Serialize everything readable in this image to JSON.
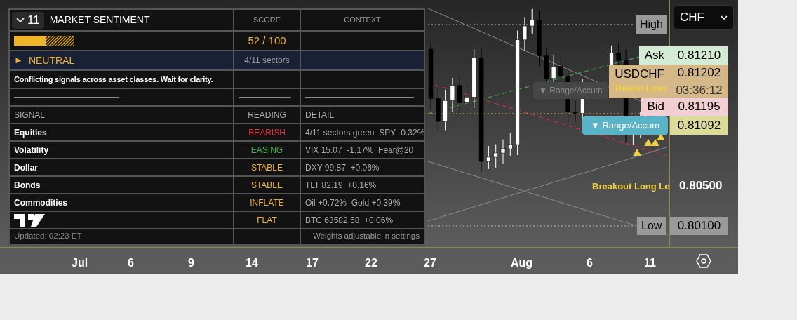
{
  "interval_button": {
    "label": "11"
  },
  "sentiment": {
    "title": "MARKET SENTIMENT",
    "columns": [
      "SCORE",
      "CONTEXT"
    ],
    "level": 0.52,
    "score": "52 / 100",
    "status": {
      "marker": "►",
      "label": "NEUTRAL",
      "sectors": "4/11 sectors"
    },
    "message": "Conflicting signals across asset classes. Wait for clarity.",
    "signal_columns": [
      "SIGNAL",
      "READING",
      "DETAIL"
    ],
    "signals": [
      {
        "name": "Equities",
        "reading": "BEARISH",
        "color": "#e0303a",
        "detail": "4/11 sectors green  SPY -0.32%"
      },
      {
        "name": "Volatility",
        "reading": "EASING",
        "color": "#3cb043",
        "detail": "VIX 15.07  -1.17%  Fear@20"
      },
      {
        "name": "Dollar",
        "reading": "STABLE",
        "color": "#f0b429",
        "detail": "DXY 99.87  +0.06%"
      },
      {
        "name": "Bonds",
        "reading": "STABLE",
        "color": "#f0b429",
        "detail": "TLT 82.19  +0.16%"
      },
      {
        "name": "Commodities",
        "reading": "INFLATE",
        "color": "#f0b429",
        "detail": "Oil +0.72%  Gold +0.39%"
      },
      {
        "reading": "FLAT",
        "color": "#f0b429",
        "detail": "BTC 63582.58  +0.06%"
      }
    ],
    "updated": "Updated: 02:23 ET",
    "footnote": "Weights adjustable in settings"
  },
  "chart_labels": [
    {
      "text": "▼ Range/Accum",
      "kind": "faded"
    },
    {
      "text": "Retest Lens",
      "kind": "note"
    },
    {
      "text": "▼ Range/Accum",
      "kind": "range"
    },
    {
      "text": "Breakout Long Le",
      "kind": "note"
    }
  ],
  "price_axis": {
    "currency": "CHF",
    "high_label": "High",
    "quotes": [
      {
        "label": "Ask",
        "value": "0.81210",
        "kind": "ask"
      },
      {
        "label": "USDCHF",
        "value": "0.81202",
        "countdown": "03:36:12",
        "kind": "last"
      },
      {
        "label": "Bid",
        "value": "0.81195",
        "kind": "bid"
      },
      {
        "value": "0.81092",
        "kind": "level"
      }
    ],
    "ticks": [
      "0.80500"
    ],
    "low": {
      "label": "Low",
      "value": "0.80100"
    }
  },
  "time_axis": [
    "Jul",
    "6",
    "9",
    "14",
    "17",
    "22",
    "27",
    "Aug",
    "6",
    "11"
  ]
}
